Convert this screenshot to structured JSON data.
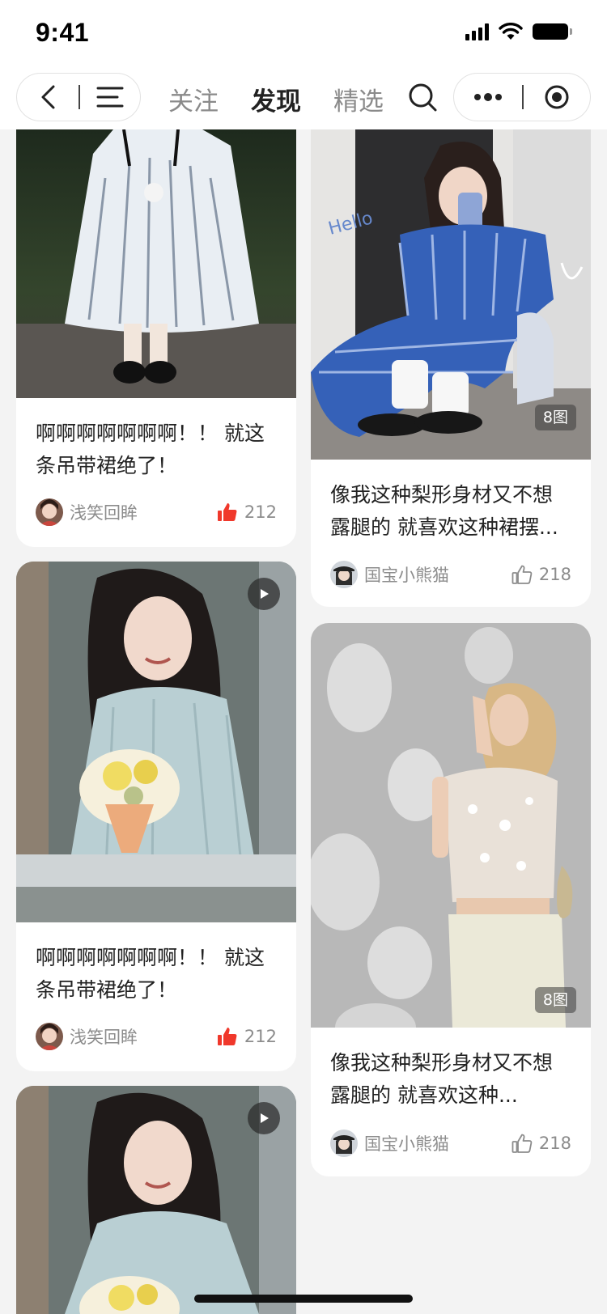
{
  "status_bar": {
    "time": "9:41"
  },
  "nav": {
    "tabs": [
      {
        "label": "关注",
        "active": false
      },
      {
        "label": "发现",
        "active": true
      },
      {
        "label": "精选",
        "active": false
      }
    ]
  },
  "feed": {
    "cards": [
      {
        "title": "啊啊啊啊啊啊啊！！ 就这条吊带裙绝了！",
        "author": "浅笑回眸",
        "likes": "212",
        "liked": true
      },
      {
        "title": "像我这种梨形身材又不想露腿的 就喜欢这种裙摆...",
        "author": "国宝小熊猫",
        "likes": "218",
        "liked": false,
        "badge": "8图"
      },
      {
        "title": "啊啊啊啊啊啊啊！！ 就这条吊带裙绝了！",
        "author": "浅笑回眸",
        "likes": "212",
        "liked": true,
        "video": true
      },
      {
        "title": "像我这种梨形身材又不想露腿的 就喜欢这种...",
        "author": "国宝小熊猫",
        "likes": "218",
        "liked": false,
        "badge": "8图"
      },
      {
        "video": true
      }
    ]
  },
  "colors": {
    "like_active": "#f0382b",
    "text_muted": "#8c8c8c",
    "background": "#f3f3f3"
  }
}
